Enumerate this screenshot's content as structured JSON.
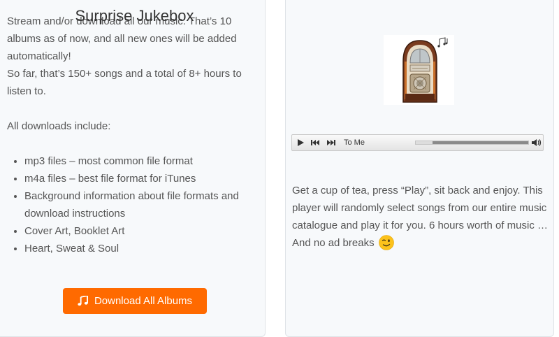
{
  "left": {
    "intro_line1": "Stream and/or download all our music. That’s 10 albums as of now, and all new ones will be added automatically!",
    "intro_line2": "So far, that’s 150+ songs and a total of 8+ hours to listen to.",
    "includes_heading": "All downloads include:",
    "features": [
      "mp3 files – most common file format",
      "m4a files – best file format for iTunes",
      "Background information about file formats and download instructions",
      "Cover Art, Booklet Art",
      "Heart, Sweat & Soul"
    ],
    "download_button_label": "Download All Albums",
    "download_button_icon": "music-note-icon",
    "accent_color": "#ff6a00"
  },
  "right": {
    "title": "Surprise Jukebox",
    "image_icon": "jukebox-icon",
    "player": {
      "track_title": "To Me",
      "progress": 0.15,
      "controls": [
        "play-icon",
        "previous-track-icon",
        "next-track-icon",
        "volume-icon"
      ]
    },
    "description": "Get a cup of tea, press “Play”, sit back and enjoy. This player will randomly select songs from our entire music catalogue and play it for you. 6 hours worth of music …  And no ad breaks",
    "emoji": "winking-face-icon"
  }
}
